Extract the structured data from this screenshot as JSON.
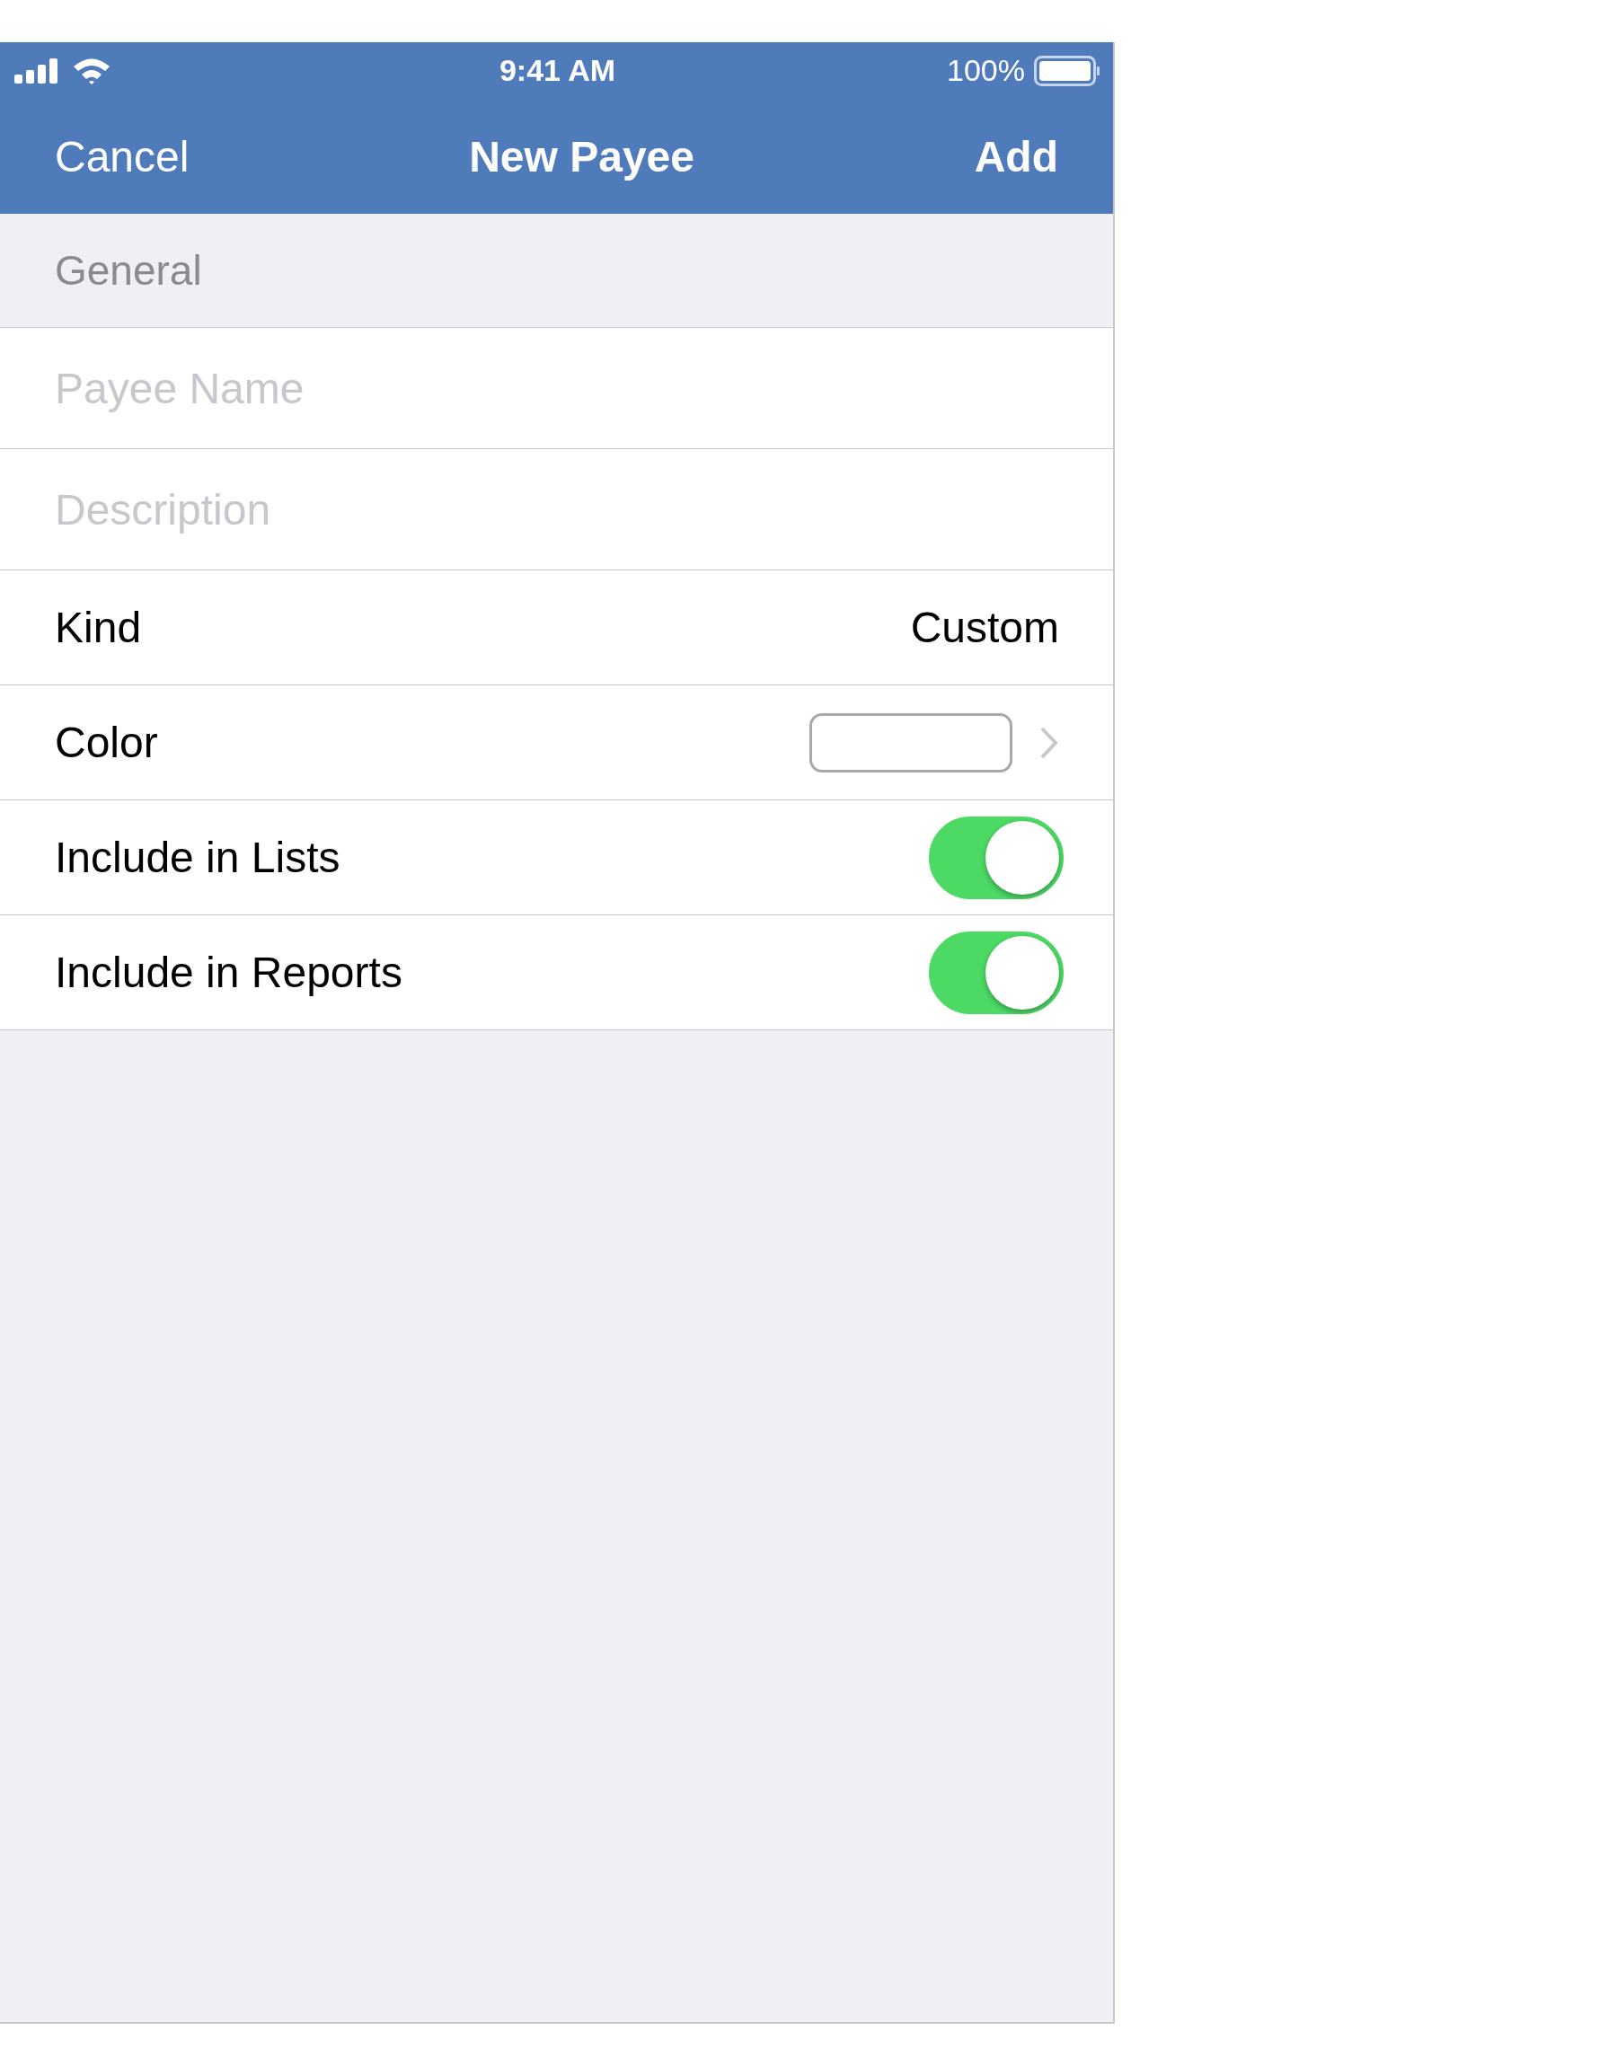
{
  "status_bar": {
    "time": "9:41 AM",
    "battery": "100%"
  },
  "nav_bar": {
    "cancel": "Cancel",
    "title": "New Payee",
    "add": "Add"
  },
  "section": {
    "title": "General"
  },
  "rows": [
    {
      "kind": "field",
      "placeholder": "Payee Name"
    },
    {
      "kind": "field",
      "placeholder": "Description"
    },
    {
      "kind": "value",
      "label": "Kind",
      "value": "Custom"
    },
    {
      "kind": "color",
      "label": "Color",
      "color": "#ffffff"
    },
    {
      "kind": "toggle",
      "label": "Include in Lists",
      "on": true
    },
    {
      "kind": "toggle",
      "label": "Include in Reports",
      "on": true
    }
  ]
}
